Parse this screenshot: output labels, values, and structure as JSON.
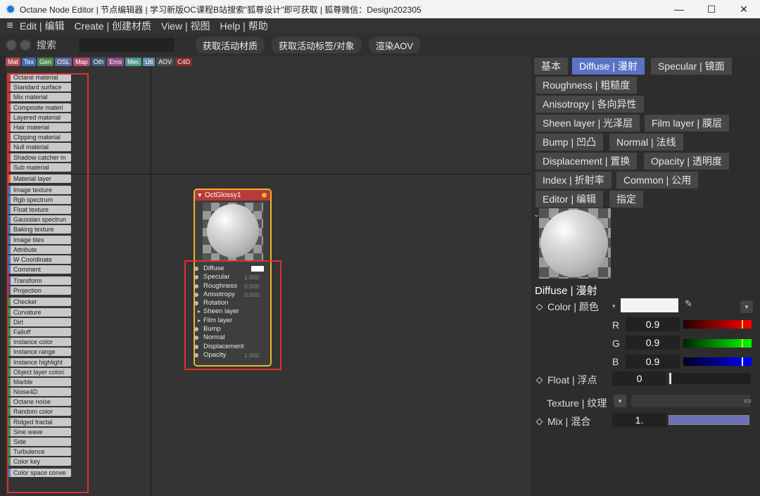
{
  "window": {
    "title": "Octane Node Editor | 节点编辑器 | 学习新版OC课程B站搜索\"狐尊设计\"即可获取 | 狐尊微信：Design202305",
    "minimize": "—",
    "maximize": "☐",
    "close": "✕"
  },
  "menu": {
    "items": [
      "Edit | 编辑",
      "Create | 创建材质",
      "View | 视图",
      "Help | 帮助"
    ]
  },
  "toolbar": {
    "search_label": "搜索",
    "search_value": "",
    "buttons": [
      "获取活动材质",
      "获取活动标签/对象",
      "渲染AOV"
    ]
  },
  "tags": [
    {
      "label": "Mat",
      "color": "#b54a4a"
    },
    {
      "label": "Tex",
      "color": "#3f6fb0"
    },
    {
      "label": "Gen",
      "color": "#4a8a4a"
    },
    {
      "label": "OSL",
      "color": "#5a6aa0"
    },
    {
      "label": "Map",
      "color": "#b04a6a"
    },
    {
      "label": "Oth",
      "color": "#3a5a7a"
    },
    {
      "label": "Ems",
      "color": "#8a4a8a"
    },
    {
      "label": "Mec",
      "color": "#4a9a8a"
    },
    {
      "label": "Utl",
      "color": "#6a8ab0"
    },
    {
      "label": "AOV",
      "color": "#4a4a4a"
    },
    {
      "label": "C4D",
      "color": "#8a2a2a"
    }
  ],
  "materials": [
    {
      "label": "Octane material",
      "color": "#c04040"
    },
    {
      "label": "Standard surface",
      "color": "#c04040"
    },
    {
      "label": "Mix material",
      "color": "#c04040"
    },
    {
      "label": "Composite materi",
      "color": "#c04040"
    },
    {
      "label": "Layered material",
      "color": "#c04040"
    },
    {
      "label": "Hair material",
      "color": "#c04040"
    },
    {
      "label": "Clipping material",
      "color": "#c04040"
    },
    {
      "label": "Null material",
      "color": "#c04040"
    },
    {
      "label": "Shadow catcher m",
      "color": "#c04040"
    },
    {
      "label": "Sub material",
      "color": "#c04040"
    },
    {
      "label": "Material layer",
      "color": "#e07020"
    },
    {
      "label": "Image texture",
      "color": "#3a7ad0"
    },
    {
      "label": "Rgb spectrum",
      "color": "#3a7ad0"
    },
    {
      "label": "Float texture",
      "color": "#3a7ad0"
    },
    {
      "label": "Gaussian spectrun",
      "color": "#3a7ad0"
    },
    {
      "label": "Baking texture",
      "color": "#3a7ad0"
    },
    {
      "label": "Image tiles",
      "color": "#3a7ad0"
    },
    {
      "label": "Attribute",
      "color": "#3a7ad0"
    },
    {
      "label": "W Coordinate",
      "color": "#3a7ad0"
    },
    {
      "label": "Comment",
      "color": "#3a7ad0"
    },
    {
      "label": "Transform",
      "color": "#5a4aa0"
    },
    {
      "label": "Projection",
      "color": "#5a4aa0"
    },
    {
      "label": "Checker",
      "color": "#3a9a4a"
    },
    {
      "label": "Curvature",
      "color": "#3a9a4a"
    },
    {
      "label": "Dirt",
      "color": "#3a9a4a"
    },
    {
      "label": "Falloff",
      "color": "#3a9a4a"
    },
    {
      "label": "Instance color",
      "color": "#3a9a4a"
    },
    {
      "label": "Instance range",
      "color": "#3a9a4a"
    },
    {
      "label": "Instance highlight",
      "color": "#3a9a4a"
    },
    {
      "label": "Object layer colori",
      "color": "#3a9a4a"
    },
    {
      "label": "Marble",
      "color": "#3a9a4a"
    },
    {
      "label": "Noise4D",
      "color": "#3a9a4a"
    },
    {
      "label": "Octane noise",
      "color": "#3a9a4a"
    },
    {
      "label": "Random color",
      "color": "#3a9a4a"
    },
    {
      "label": "Ridged fractal",
      "color": "#3a9a4a"
    },
    {
      "label": "Sine wave",
      "color": "#3a9a4a"
    },
    {
      "label": "Side",
      "color": "#3a9a4a"
    },
    {
      "label": "Turbulence",
      "color": "#3a9a4a"
    },
    {
      "label": "Color key",
      "color": "#3a9a4a"
    },
    {
      "label": "Color space conve",
      "color": "#4a8ad0"
    }
  ],
  "node": {
    "title": "OctGlossy1",
    "ports": [
      {
        "label": "Diffuse",
        "value": ""
      },
      {
        "label": "Specular",
        "value": "1.000"
      },
      {
        "label": "Roughness",
        "value": "0.000"
      },
      {
        "label": "Anisotropy",
        "value": "0.000"
      },
      {
        "label": "Rotation",
        "value": ""
      },
      {
        "label": "Sheen layer",
        "value": ""
      },
      {
        "label": "Film layer",
        "value": ""
      },
      {
        "label": "Bump",
        "value": ""
      },
      {
        "label": "Normal",
        "value": ""
      },
      {
        "label": "Displacement",
        "value": ""
      },
      {
        "label": "Opacity",
        "value": "1.000"
      }
    ]
  },
  "tabs": [
    {
      "label": "基本"
    },
    {
      "label": "Diffuse | 漫射"
    },
    {
      "label": "Specular | 镜面"
    },
    {
      "label": "Roughness | 粗糙度"
    },
    {
      "label": "Anisotropy | 各向异性"
    },
    {
      "label": "Sheen layer | 光泽层"
    },
    {
      "label": "Film layer | 膜层"
    },
    {
      "label": "Bump | 凹凸"
    },
    {
      "label": "Normal | 法线"
    },
    {
      "label": "Displacement | 置换"
    },
    {
      "label": "Opacity | 透明度"
    },
    {
      "label": "Index | 折射率"
    },
    {
      "label": "Common | 公用"
    },
    {
      "label": "Editor | 编辑"
    },
    {
      "label": "指定"
    }
  ],
  "props": {
    "section_title": "Diffuse | 漫射",
    "color_label": "Color | 颜色",
    "r_label": "R",
    "g_label": "G",
    "b_label": "B",
    "r_value": "0.9",
    "g_value": "0.9",
    "b_value": "0.9",
    "float_label": "Float | 浮点",
    "float_value": "0",
    "texture_label": "Texture | 纹理",
    "mix_label": "Mix | 混合",
    "mix_value": "1."
  }
}
